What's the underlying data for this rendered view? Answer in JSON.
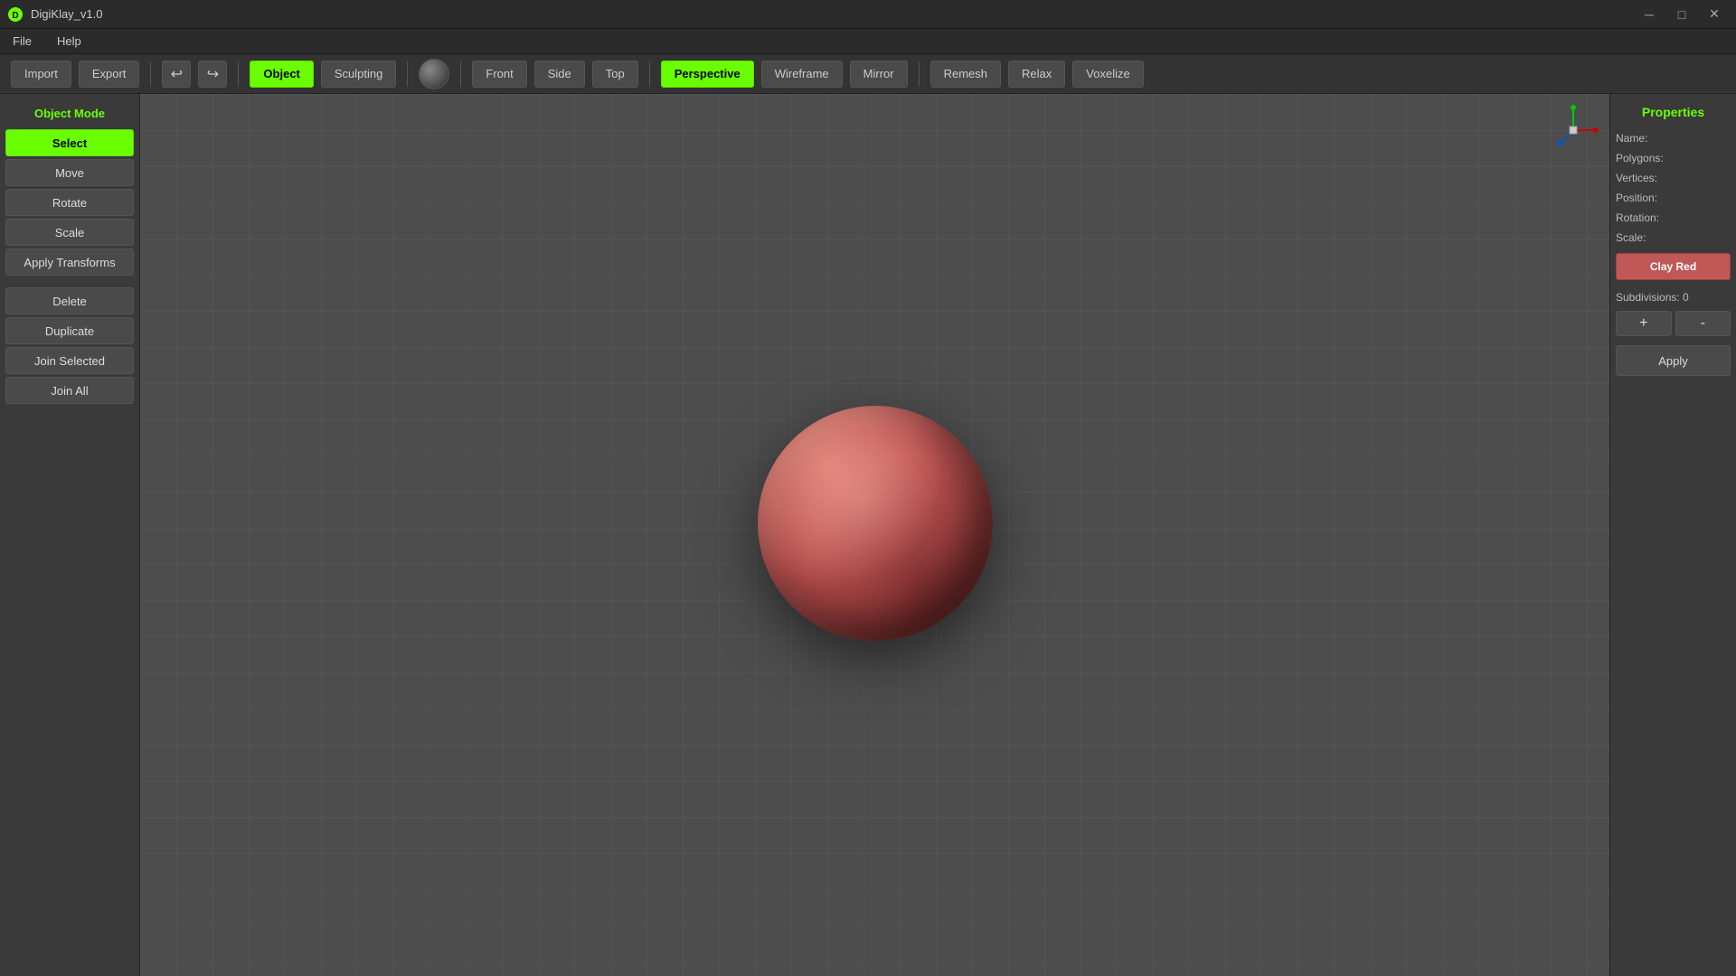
{
  "titlebar": {
    "app_name": "DigiKlay_v1.0",
    "minimize_label": "─",
    "maximize_label": "□",
    "close_label": "✕"
  },
  "menubar": {
    "items": [
      {
        "id": "file",
        "label": "File"
      },
      {
        "id": "help",
        "label": "Help"
      }
    ]
  },
  "toolbar": {
    "import_label": "Import",
    "export_label": "Export",
    "undo_icon": "↩",
    "redo_icon": "↪",
    "object_label": "Object",
    "sculpting_label": "Sculpting",
    "front_label": "Front",
    "side_label": "Side",
    "top_label": "Top",
    "perspective_label": "Perspective",
    "wireframe_label": "Wireframe",
    "mirror_label": "Mirror",
    "remesh_label": "Remesh",
    "relax_label": "Relax",
    "voxelize_label": "Voxelize"
  },
  "left_panel": {
    "mode_label": "Object Mode",
    "select_label": "Select",
    "move_label": "Move",
    "rotate_label": "Rotate",
    "scale_label": "Scale",
    "apply_transforms_label": "Apply Transforms",
    "delete_label": "Delete",
    "duplicate_label": "Duplicate",
    "join_selected_label": "Join Selected",
    "join_all_label": "Join All"
  },
  "properties": {
    "title": "Properties",
    "name_label": "Name:",
    "polygons_label": "Polygons:",
    "vertices_label": "Vertices:",
    "position_label": "Position:",
    "rotation_label": "Rotation:",
    "scale_label": "Scale:",
    "material_label": "Clay Red",
    "subdivisions_label": "Subdivisions: 0",
    "add_subdiv_label": "+",
    "remove_subdiv_label": "-",
    "apply_label": "Apply"
  }
}
